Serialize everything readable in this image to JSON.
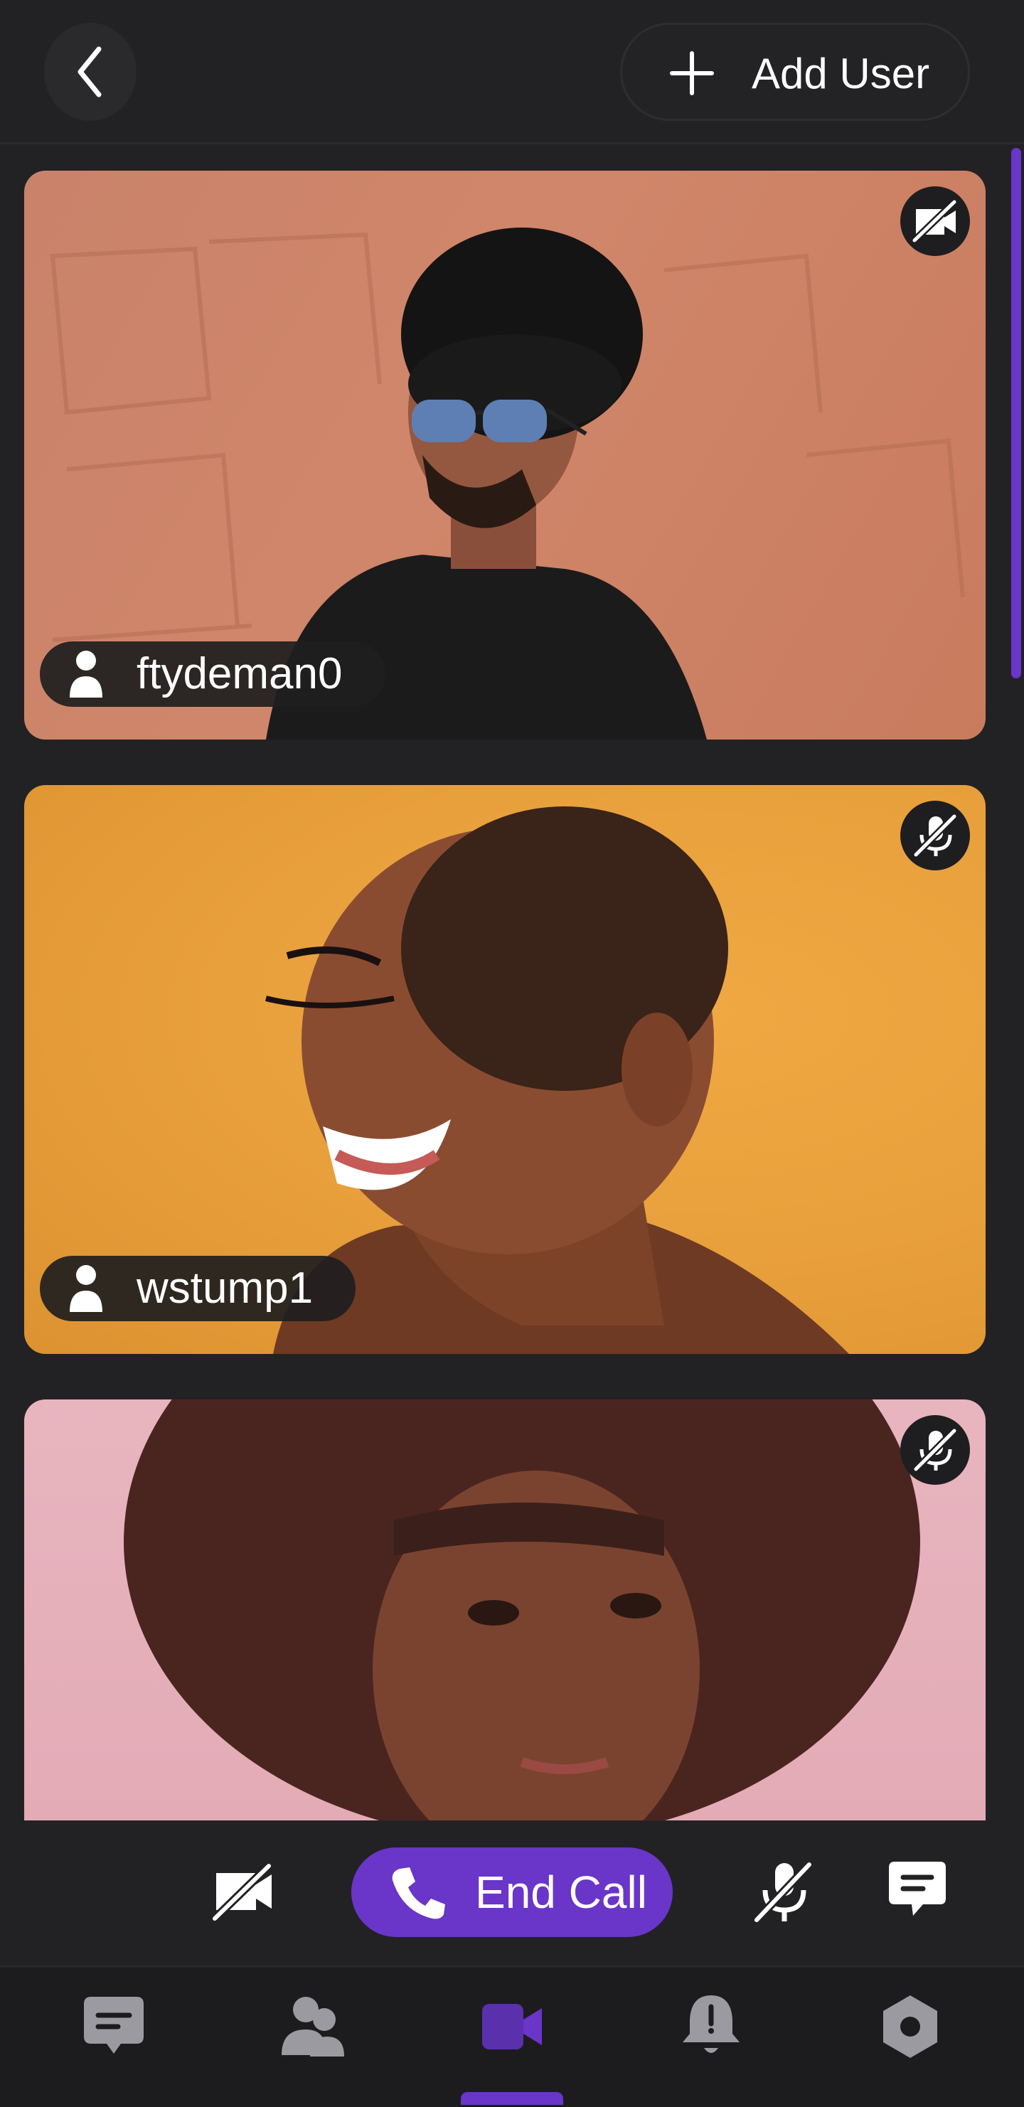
{
  "header": {
    "back_icon": "chevron-left-icon",
    "add_user_label": "Add User",
    "add_user_icon": "plus-icon"
  },
  "participants": [
    {
      "username": "ftydeman0",
      "status_icon": "camera-off-icon",
      "backdrop_color": "#c9836a"
    },
    {
      "username": "wstump1",
      "status_icon": "microphone-off-icon",
      "backdrop_color": "#e8a03c"
    },
    {
      "username": "",
      "status_icon": "microphone-off-icon",
      "backdrop_color": "#e8b5bf"
    }
  ],
  "controls": {
    "camera_icon": "camera-off-icon",
    "end_call_label": "End Call",
    "end_call_icon": "phone-icon",
    "mic_icon": "microphone-off-icon",
    "chat_icon": "chat-icon"
  },
  "tabs": [
    {
      "icon": "messages-icon",
      "active": false
    },
    {
      "icon": "contacts-icon",
      "active": false
    },
    {
      "icon": "video-icon",
      "active": true
    },
    {
      "icon": "notifications-icon",
      "active": false
    },
    {
      "icon": "settings-icon",
      "active": false
    }
  ],
  "colors": {
    "accent": "#6a35c9",
    "background": "#222224",
    "tabbar": "#1c1c1e",
    "inactive_icon": "#9a9aa0"
  }
}
